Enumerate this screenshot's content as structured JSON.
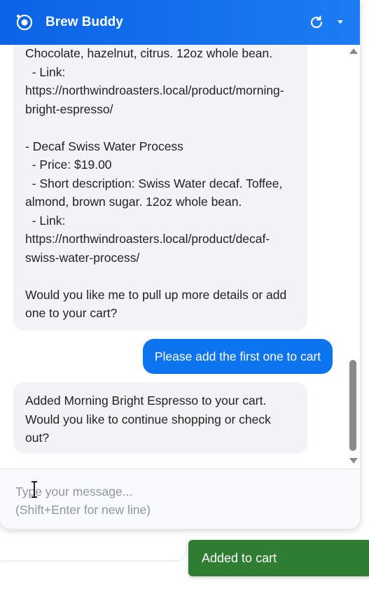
{
  "header": {
    "title": "Brew Buddy",
    "refresh_icon": "refresh-icon",
    "menu_icon": "caret-down-icon",
    "logo_icon": "logo-icon"
  },
  "messages": {
    "bot_1_lines": [
      "Chocolate, hazelnut, citrus. 12oz whole bean.",
      "  - Link:",
      "https://northwindroasters.local/product/morning-",
      "bright-espresso/",
      "",
      "- Decaf Swiss Water Process",
      "  - Price: $19.00",
      "  - Short description: Swiss Water decaf. Toffee,",
      "almond, brown sugar. 12oz whole bean.",
      "  - Link:",
      "https://northwindroasters.local/product/decaf-",
      "swiss-water-process/",
      "",
      "Would you like me to pull up more details or add",
      "one to your cart?"
    ],
    "user_1": "Please add the first one to cart",
    "bot_2_lines": [
      "Added Morning Bright Espresso to your cart.",
      "Would you like to continue shopping or check",
      "out?"
    ]
  },
  "composer": {
    "placeholder": "Type your message...\n(Shift+Enter for new line)"
  },
  "toast": {
    "text": "Added to cart"
  },
  "colors": {
    "header": "#0b63e5",
    "user_bubble": "#0d74f0",
    "bot_bubble": "#f1f3f7",
    "toast": "#2f7d32"
  }
}
